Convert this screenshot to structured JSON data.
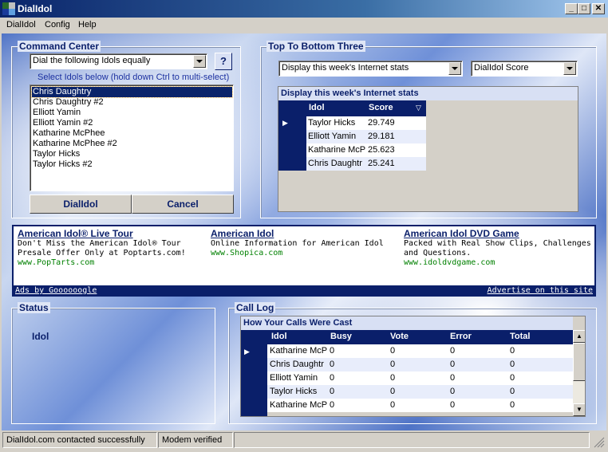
{
  "window": {
    "title": "DialIdol"
  },
  "menu": [
    "DialIdol",
    "Config",
    "Help"
  ],
  "command_center": {
    "title": "Command Center",
    "mode_select": "Dial the following Idols equally",
    "help_button": "?",
    "instruction": "Select Idols below (hold down Ctrl to multi-select)",
    "idols": [
      "Chris Daughtry",
      "Chris Daughtry #2",
      "Elliott Yamin",
      "Elliott Yamin #2",
      "Katharine McPhee",
      "Katharine McPhee #2",
      "Taylor Hicks",
      "Taylor Hicks #2"
    ],
    "selected_index": 0,
    "dial_button": "DialIdol",
    "cancel_button": "Cancel"
  },
  "top_bottom": {
    "title": "Top To Bottom Three",
    "stats_select": "Display this week's Internet stats",
    "score_select": "DialIdol Score",
    "grid_caption": "Display this week's Internet stats",
    "columns": [
      "Idol",
      "Score"
    ],
    "rows": [
      {
        "idol": "Taylor Hicks",
        "score": "29.749"
      },
      {
        "idol": "Elliott Yamin",
        "score": "29.181"
      },
      {
        "idol": "Katharine McP",
        "score": "25.623"
      },
      {
        "idol": "Chris Daughtr",
        "score": "25.241"
      }
    ]
  },
  "ads": [
    {
      "title": "American Idol® Live Tour",
      "line1": "Don't Miss the American Idol® Tour",
      "line2": "Presale Offer Only at Poptarts.com!",
      "url": "www.PopTarts.com"
    },
    {
      "title": "American Idol",
      "line1": "Online Information for American Idol",
      "line2": "",
      "url": "www.Shopica.com"
    },
    {
      "title": "American Idol DVD Game",
      "line1": "Packed with Real Show Clips, Challenges",
      "line2": "and Questions.",
      "url": "www.idoldvdgame.com"
    }
  ],
  "ads_footer": {
    "left": "Ads by Goooooogle",
    "right": "Advertise on this site"
  },
  "status": {
    "title": "Status",
    "label": "Idol"
  },
  "call_log": {
    "title": "Call Log",
    "caption": "How Your Calls Were Cast",
    "columns": [
      "Idol",
      "Busy",
      "Vote",
      "Error",
      "Total"
    ],
    "rows": [
      {
        "idol": "Katharine McP",
        "busy": "0",
        "vote": "0",
        "error": "0",
        "total": "0"
      },
      {
        "idol": "Chris Daughtr",
        "busy": "0",
        "vote": "0",
        "error": "0",
        "total": "0"
      },
      {
        "idol": "Elliott Yamin",
        "busy": "0",
        "vote": "0",
        "error": "0",
        "total": "0"
      },
      {
        "idol": "Taylor Hicks",
        "busy": "0",
        "vote": "0",
        "error": "0",
        "total": "0"
      },
      {
        "idol": "Katharine McP",
        "busy": "0",
        "vote": "0",
        "error": "0",
        "total": "0"
      }
    ]
  },
  "statusbar": [
    "DialIdol.com contacted successfully",
    "Modem verified",
    ""
  ],
  "colors": {
    "titlebar": "#0a246a",
    "grid_header": "#0a1f6a",
    "selection": "#0a246a",
    "link_url": "#008000"
  },
  "icons": [
    "app-icon",
    "minimize-icon",
    "maximize-icon",
    "close-icon",
    "help-icon",
    "dropdown-arrow-icon",
    "row-pointer-icon",
    "sort-icon",
    "scroll-up-icon",
    "scroll-down-icon",
    "size-grip-icon"
  ]
}
